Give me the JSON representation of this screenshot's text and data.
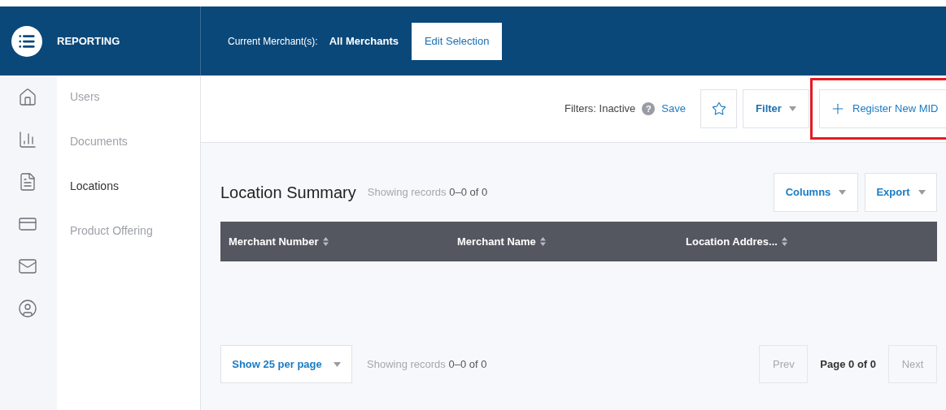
{
  "header": {
    "app_title": "REPORTING",
    "merchant_label": "Current Merchant(s):",
    "merchant_value": "All Merchants",
    "edit_button": "Edit Selection"
  },
  "nav_items": [
    {
      "label": "Users",
      "selected": false
    },
    {
      "label": "Documents",
      "selected": false
    },
    {
      "label": "Locations",
      "selected": true
    },
    {
      "label": "Product Offering",
      "selected": false
    }
  ],
  "toolbar": {
    "filters_status": "Filters: Inactive",
    "help": "?",
    "save": "Save",
    "filter_button": "Filter",
    "register_button": "Register New MID",
    "register_highlighted": true
  },
  "summary": {
    "title": "Location Summary",
    "records_label": "Showing records",
    "records_range": "0–0 of 0",
    "columns_button": "Columns",
    "export_button": "Export"
  },
  "table": {
    "columns": [
      "Merchant Number",
      "Merchant Name",
      "Location Addres..."
    ]
  },
  "footer": {
    "page_size": "Show 25 per page",
    "records_label": "Showing records",
    "records_range": "0–0 of 0",
    "prev": "Prev",
    "page_info": "Page 0 of 0",
    "next": "Next"
  }
}
